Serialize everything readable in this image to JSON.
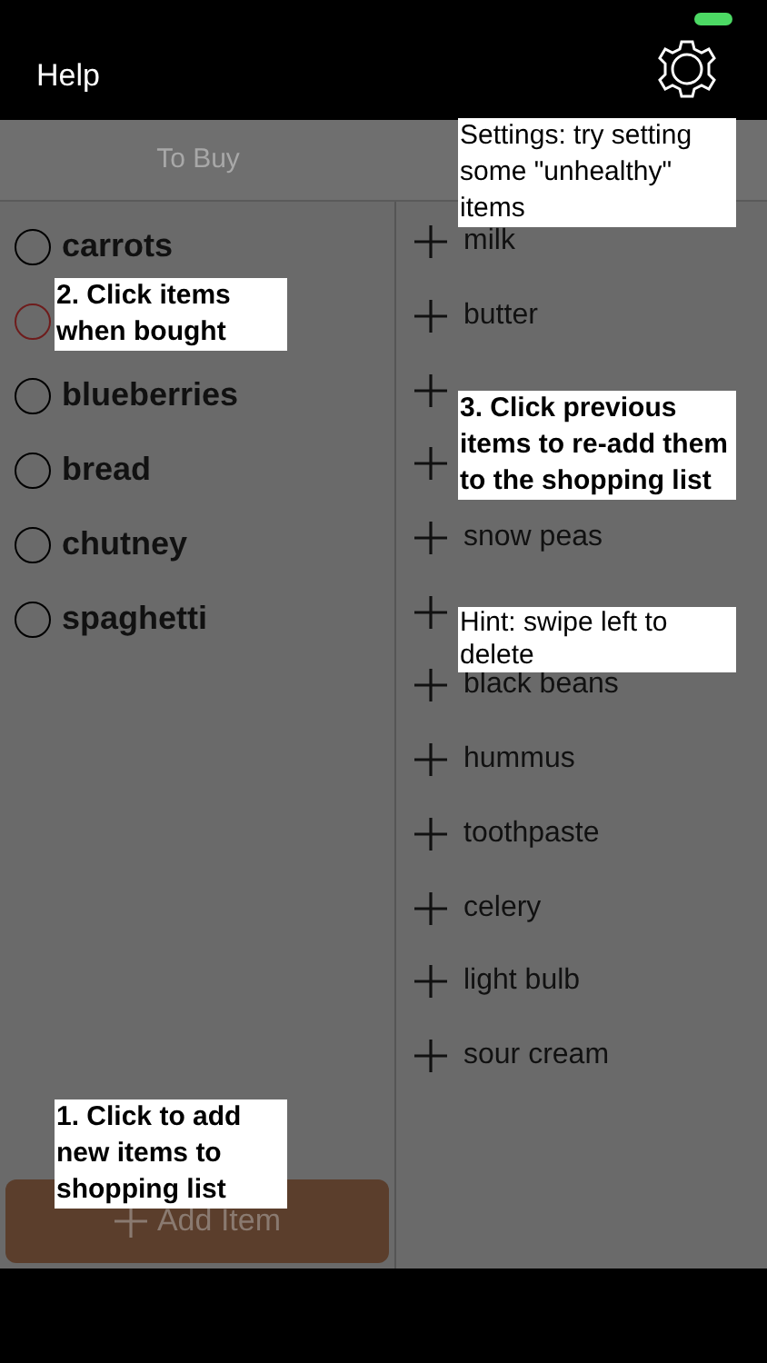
{
  "nav": {
    "left": "Help"
  },
  "tabs": [
    {
      "label": "To Buy",
      "selected": false
    }
  ],
  "to_buy": [
    {
      "label": "carrots",
      "color": "#000000"
    },
    {
      "color": "#6e1c1c"
    },
    {
      "label": "blueberries",
      "color": "#000000"
    },
    {
      "label": "bread",
      "color": "#000000"
    },
    {
      "label": "chutney",
      "color": "#000000"
    },
    {
      "label": "spaghetti",
      "color": "#000000"
    }
  ],
  "previous": [
    {
      "kind": "item",
      "label": "milk"
    },
    {
      "kind": "item",
      "label": "butter"
    },
    {
      "kind": "covered"
    },
    {
      "kind": "covered"
    },
    {
      "kind": "item",
      "label": "snow peas"
    },
    {
      "kind": "covered"
    },
    {
      "kind": "item",
      "label": "black beans"
    },
    {
      "kind": "item",
      "label": "hummus"
    },
    {
      "kind": "item",
      "label": "toothpaste"
    },
    {
      "kind": "item",
      "label": "celery"
    },
    {
      "kind": "item",
      "label": "light bulb"
    },
    {
      "kind": "item",
      "label": "sour cream"
    }
  ],
  "add_button": "Add Item",
  "callouts": [
    {
      "kind": "plain",
      "text": "Settings: try setting some \"unhealthy\" items"
    },
    {
      "kind": "bold",
      "text": "2. Click items when bought"
    },
    {
      "kind": "bold",
      "text": "3. Click previous items to re-add them to the shopping list"
    },
    {
      "kind": "plain",
      "text": "Hint: swipe left to delete"
    },
    {
      "kind": "bold",
      "text": "1. Click to add new items to shopping list"
    }
  ]
}
